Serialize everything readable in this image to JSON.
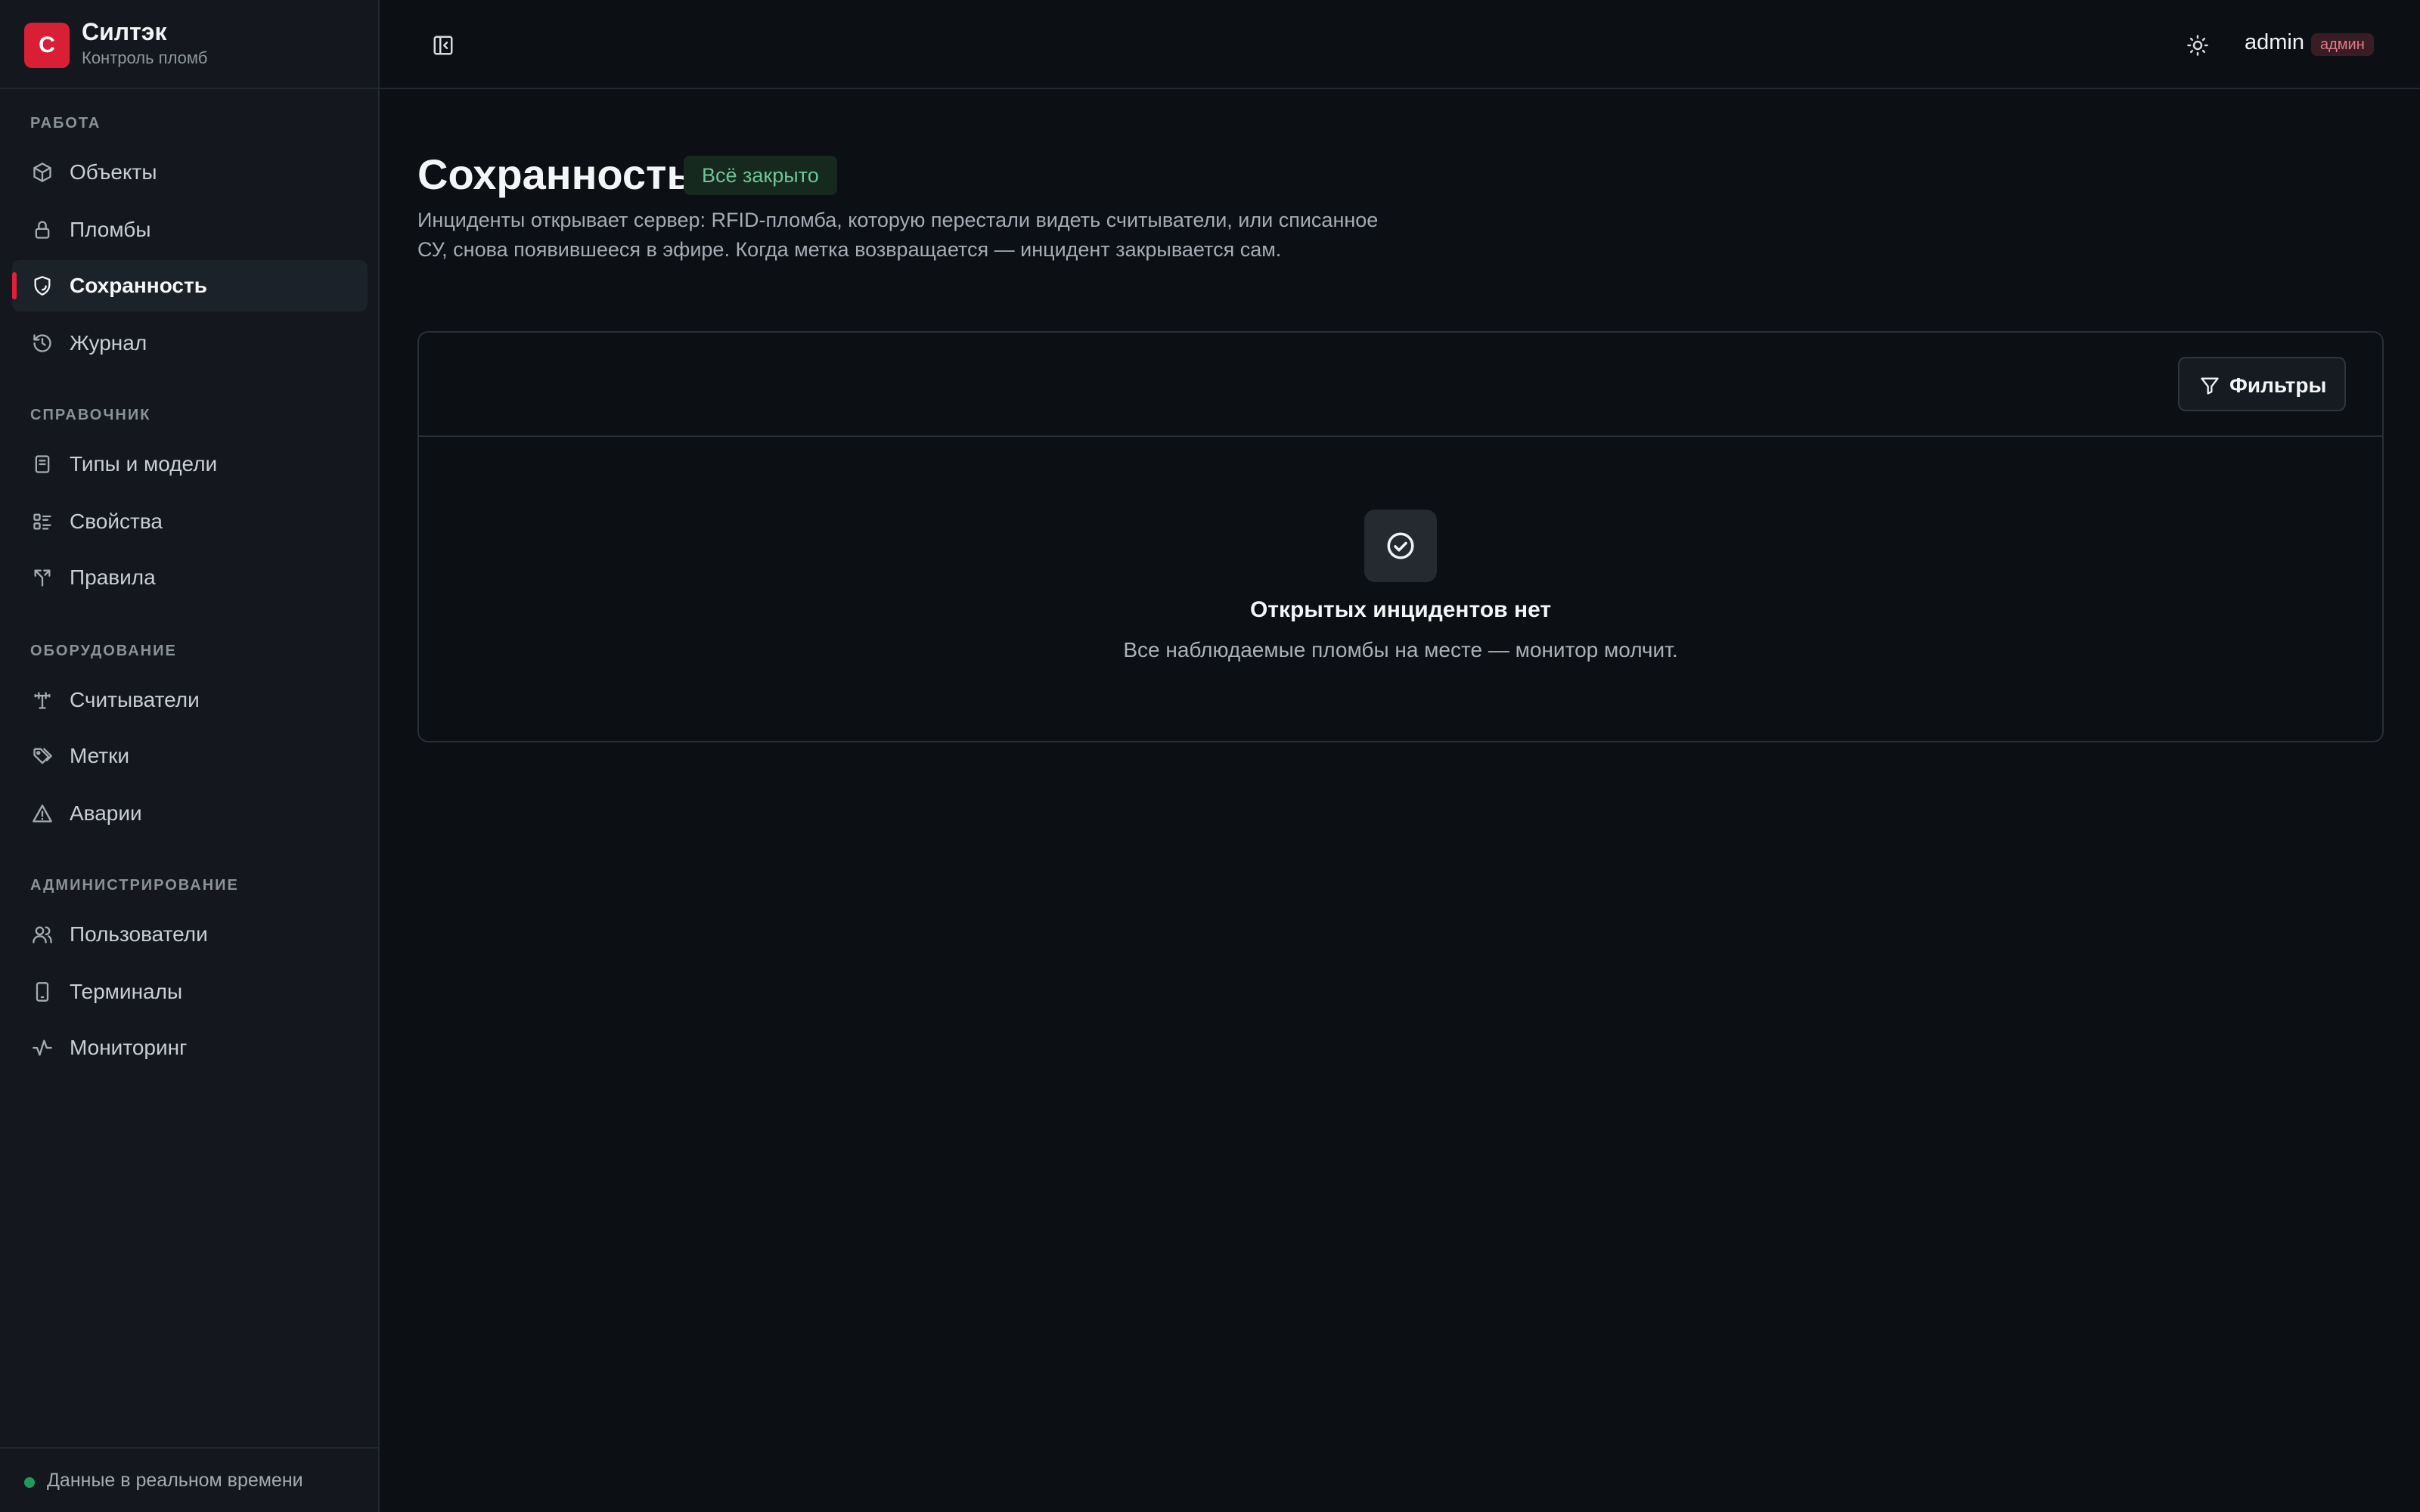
{
  "brand": {
    "logo_letter": "С",
    "name": "Силтэк",
    "subtitle": "Контроль пломб"
  },
  "sidebar": {
    "sections": [
      {
        "title": "РАБОТА",
        "items": [
          {
            "label": "Объекты",
            "icon": "cube-icon"
          },
          {
            "label": "Пломбы",
            "icon": "lock-icon"
          },
          {
            "label": "Сохранность",
            "icon": "shield-icon",
            "active": true
          },
          {
            "label": "Журнал",
            "icon": "history-icon"
          }
        ]
      },
      {
        "title": "СПРАВОЧНИК",
        "items": [
          {
            "label": "Типы и модели",
            "icon": "book-icon"
          },
          {
            "label": "Свойства",
            "icon": "list-icon"
          },
          {
            "label": "Правила",
            "icon": "split-arrow-icon"
          }
        ]
      },
      {
        "title": "ОБОРУДОВАНИЕ",
        "items": [
          {
            "label": "Считыватели",
            "icon": "antenna-icon"
          },
          {
            "label": "Метки",
            "icon": "tags-icon"
          },
          {
            "label": "Аварии",
            "icon": "warning-icon"
          }
        ]
      },
      {
        "title": "АДМИНИСТРИРОВАНИЕ",
        "items": [
          {
            "label": "Пользователи",
            "icon": "users-icon"
          },
          {
            "label": "Терминалы",
            "icon": "smartphone-icon"
          },
          {
            "label": "Мониторинг",
            "icon": "activity-icon"
          }
        ]
      }
    ],
    "footer_status": "Данные в реальном времени"
  },
  "header": {
    "user_name": "admin",
    "role_badge": "админ"
  },
  "main": {
    "title": "Сохранность",
    "status_badge": "Всё закрыто",
    "description": "Инциденты открывает сервер: RFID-пломба, которую перестали видеть считыватели, или списанное СУ, снова появившееся в эфире. Когда метка возвращается — инцидент закрывается сам.",
    "filter_button": "Фильтры",
    "empty_title": "Открытых инцидентов нет",
    "empty_text": "Все наблюдаемые пломбы на месте — монитор молчит."
  },
  "colors": {
    "accent": "#d81f35",
    "status_ok": "#6fc596",
    "live_indicator": "#1f9a5c"
  }
}
